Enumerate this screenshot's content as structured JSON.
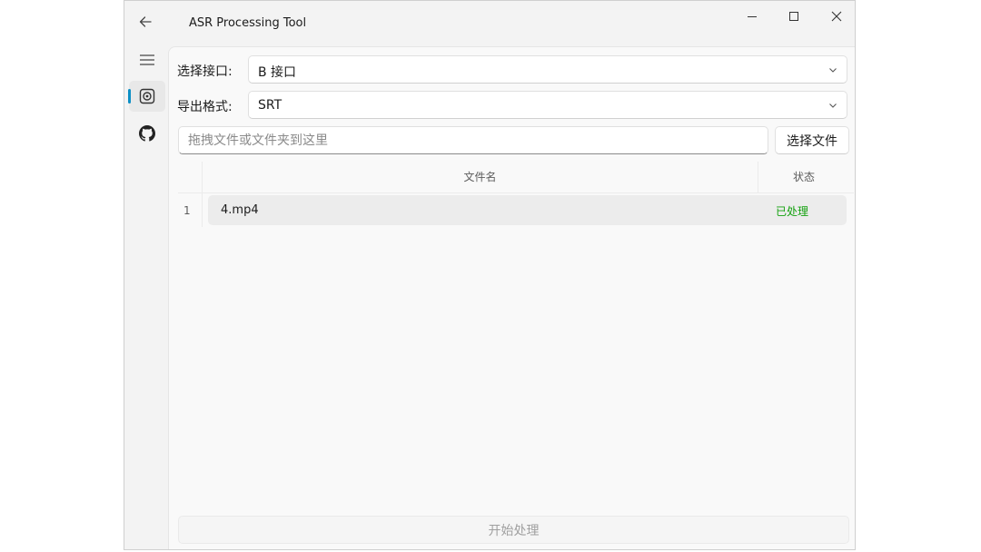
{
  "app": {
    "title": "ASR Processing Tool"
  },
  "titlebar": {
    "back_icon": "arrow-left-icon",
    "minimize_icon": "minimize-icon",
    "maximize_icon": "maximize-icon",
    "close_icon": "close-icon"
  },
  "nav": {
    "items": [
      {
        "icon": "hamburger-menu-icon",
        "selected": false
      },
      {
        "icon": "disc-icon",
        "selected": true
      },
      {
        "icon": "github-icon",
        "selected": false
      }
    ],
    "accent": "#0c8fc5"
  },
  "form": {
    "interface_label": "选择接口:",
    "interface_value": "B 接口",
    "format_label": "导出格式:",
    "format_value": "SRT",
    "drop_placeholder": "拖拽文件或文件夹到这里",
    "choose_file_label": "选择文件"
  },
  "table": {
    "headers": [
      "文件名",
      "状态"
    ],
    "rows": [
      {
        "index": "1",
        "name": "4.mp4",
        "status": "已处理"
      }
    ],
    "status_color": "#13a10e"
  },
  "actions": {
    "start_label": "开始处理"
  }
}
